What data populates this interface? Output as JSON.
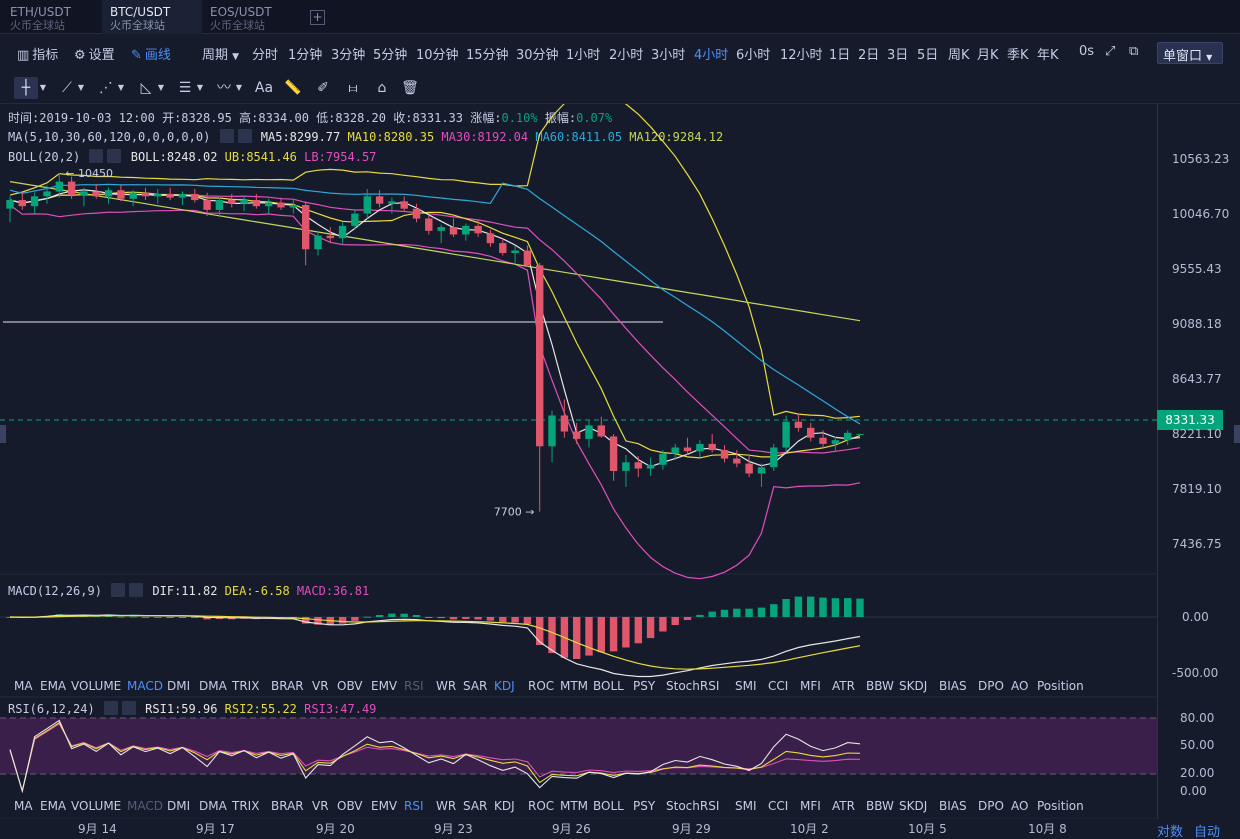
{
  "tabs": [
    {
      "pair": "ETH/USDT",
      "exchange": "火币全球站",
      "active": false
    },
    {
      "pair": "BTC/USDT",
      "exchange": "火币全球站",
      "active": true
    },
    {
      "pair": "EOS/USDT",
      "exchange": "火币全球站",
      "active": false
    }
  ],
  "toolbar": {
    "indicator": "指标",
    "settings": "设置",
    "draw": "画线",
    "period": "周期",
    "intervals": [
      "分时",
      "1分钟",
      "3分钟",
      "5分钟",
      "10分钟",
      "15分钟",
      "30分钟",
      "1小时",
      "2小时",
      "3小时",
      "4小时",
      "6小时",
      "12小时",
      "1日",
      "2日",
      "3日",
      "5日",
      "周K",
      "月K",
      "季K",
      "年K"
    ],
    "active_interval": "4小时",
    "countdown": "0s",
    "window_mode": "单窗口"
  },
  "info": {
    "time_label": "时间:",
    "time": "2019-10-03 12:00",
    "open_label": "开:",
    "open": "8328.95",
    "high_label": "高:",
    "high": "8334.00",
    "low_label": "低:",
    "low": "8328.20",
    "close_label": "收:",
    "close": "8331.33",
    "change_label": "涨幅:",
    "change": "0.10%",
    "amp_label": "振幅:",
    "amp": "0.07%"
  },
  "ma": {
    "params": "MA(5,10,30,60,120,0,0,0,0,0)",
    "ma5": "MA5:8299.77",
    "ma10": "MA10:8280.35",
    "ma30": "MA30:8192.04",
    "ma60": "MA60:8411.05",
    "ma120": "MA120:9284.12"
  },
  "boll": {
    "params": "BOLL(20,2)",
    "boll": "BOLL:8248.02",
    "ub": "UB:8541.46",
    "lb": "LB:7954.57"
  },
  "macd": {
    "params": "MACD(12,26,9)",
    "dif": "DIF:11.82",
    "dea": "DEA:-6.58",
    "macd": "MACD:36.81"
  },
  "rsi": {
    "params": "RSI(6,12,24)",
    "rsi1": "RSI1:59.96",
    "rsi2": "RSI2:55.22",
    "rsi3": "RSI3:47.49"
  },
  "indicator_list": [
    "MA",
    "EMA",
    "VOLUME",
    "MACD",
    "DMI",
    "DMA",
    "TRIX",
    "BRAR",
    "VR",
    "OBV",
    "EMV",
    "RSI",
    "WR",
    "SAR",
    "KDJ",
    "ROC",
    "MTM",
    "BOLL",
    "PSY",
    "StochRSI",
    "SMI",
    "CCI",
    "MFI",
    "ATR",
    "BBW",
    "SKDJ",
    "BIAS",
    "DPO",
    "AO",
    "Position"
  ],
  "indicator_list_1_active": "MACD",
  "indicator_list_1_active2": "KDJ",
  "indicator_list_1_dim": "RSI",
  "indicator_list_2_active": "RSI",
  "indicator_list_2_dim": "MACD",
  "price_axis": [
    "10563.23",
    "10046.70",
    "9555.43",
    "9088.18",
    "8643.77",
    "8221.10",
    "7819.10",
    "7436.75"
  ],
  "last_price": "8331.33",
  "high_marker": "← 10450",
  "low_marker": "7700 →",
  "macd_axis": [
    "0.00",
    "-500.00"
  ],
  "rsi_axis": [
    "80.00",
    "50.00",
    "20.00",
    "0.00"
  ],
  "date_axis": [
    "9月 14",
    "9月 17",
    "9月 20",
    "9月 23",
    "9月 26",
    "9月 29",
    "10月 2",
    "10月 5",
    "10月 8"
  ],
  "corner": {
    "log": "对数",
    "auto": "自动"
  },
  "colors": {
    "bg": "#161b2c",
    "up": "#05a47a",
    "down": "#e0566a",
    "accent": "#4e8ef7",
    "ma5": "#e6e6e6",
    "ma10": "#e8dc3c",
    "ma30": "#e04fbd",
    "ma60": "#2fa8d8",
    "ma120": "#c4d65a"
  },
  "chart_data": {
    "type": "candlestick",
    "series_names": [
      "MA5",
      "MA10",
      "MA30",
      "MA60",
      "MA120",
      "BOLL",
      "UB",
      "LB"
    ],
    "candles": [
      [
        10160,
        10260,
        10050,
        10230
      ],
      [
        10230,
        10300,
        10150,
        10180
      ],
      [
        10180,
        10290,
        10120,
        10260
      ],
      [
        10260,
        10350,
        10200,
        10300
      ],
      [
        10300,
        10450,
        10250,
        10380
      ],
      [
        10380,
        10420,
        10240,
        10270
      ],
      [
        10270,
        10330,
        10180,
        10300
      ],
      [
        10300,
        10360,
        10240,
        10260
      ],
      [
        10260,
        10330,
        10200,
        10310
      ],
      [
        10310,
        10350,
        10220,
        10240
      ],
      [
        10240,
        10310,
        10180,
        10290
      ],
      [
        10290,
        10330,
        10230,
        10260
      ],
      [
        10260,
        10320,
        10200,
        10280
      ],
      [
        10280,
        10330,
        10230,
        10250
      ],
      [
        10250,
        10300,
        10190,
        10280
      ],
      [
        10280,
        10320,
        10210,
        10230
      ],
      [
        10230,
        10290,
        10100,
        10150
      ],
      [
        10150,
        10250,
        10090,
        10230
      ],
      [
        10230,
        10280,
        10170,
        10200
      ],
      [
        10200,
        10260,
        10140,
        10230
      ],
      [
        10230,
        10280,
        10160,
        10180
      ],
      [
        10180,
        10240,
        10120,
        10210
      ],
      [
        10210,
        10250,
        10150,
        10170
      ],
      [
        10170,
        10230,
        10120,
        10190
      ],
      [
        10190,
        10220,
        9700,
        9830
      ],
      [
        9830,
        9980,
        9780,
        9940
      ],
      [
        9940,
        10010,
        9880,
        9920
      ],
      [
        9920,
        10050,
        9870,
        10020
      ],
      [
        10020,
        10150,
        9990,
        10120
      ],
      [
        10120,
        10320,
        10080,
        10260
      ],
      [
        10260,
        10310,
        10170,
        10200
      ],
      [
        10200,
        10250,
        10120,
        10220
      ],
      [
        10220,
        10260,
        10140,
        10160
      ],
      [
        10160,
        10200,
        10050,
        10080
      ],
      [
        10080,
        10110,
        9950,
        9980
      ],
      [
        9980,
        10030,
        9880,
        10010
      ],
      [
        10010,
        10080,
        9930,
        9950
      ],
      [
        9950,
        10040,
        9900,
        10020
      ],
      [
        10020,
        10070,
        9930,
        9960
      ],
      [
        9960,
        9990,
        9850,
        9880
      ],
      [
        9880,
        9920,
        9780,
        9800
      ],
      [
        9800,
        9860,
        9720,
        9820
      ],
      [
        9820,
        9860,
        9690,
        9700
      ],
      [
        9700,
        9720,
        7700,
        8230
      ],
      [
        8230,
        8520,
        8100,
        8480
      ],
      [
        8480,
        8610,
        8300,
        8350
      ],
      [
        8350,
        8420,
        8250,
        8290
      ],
      [
        8290,
        8440,
        8220,
        8400
      ],
      [
        8400,
        8470,
        8300,
        8310
      ],
      [
        8310,
        8330,
        7950,
        8030
      ],
      [
        8030,
        8160,
        7900,
        8100
      ],
      [
        8100,
        8150,
        7980,
        8050
      ],
      [
        8050,
        8140,
        7990,
        8080
      ],
      [
        8080,
        8200,
        8040,
        8170
      ],
      [
        8170,
        8250,
        8120,
        8220
      ],
      [
        8220,
        8300,
        8160,
        8190
      ],
      [
        8190,
        8280,
        8140,
        8250
      ],
      [
        8250,
        8330,
        8180,
        8200
      ],
      [
        8200,
        8240,
        8100,
        8130
      ],
      [
        8130,
        8200,
        8060,
        8090
      ],
      [
        8090,
        8160,
        7980,
        8010
      ],
      [
        8010,
        8090,
        7900,
        8060
      ],
      [
        8060,
        8250,
        8030,
        8220
      ],
      [
        8220,
        8480,
        8180,
        8430
      ],
      [
        8430,
        8500,
        8350,
        8380
      ],
      [
        8380,
        8420,
        8270,
        8300
      ],
      [
        8300,
        8360,
        8210,
        8250
      ],
      [
        8250,
        8310,
        8190,
        8280
      ],
      [
        8280,
        8360,
        8240,
        8340
      ],
      [
        8329,
        8334,
        8328,
        8331
      ]
    ],
    "ma_summary": {
      "MA5": 8299.77,
      "MA10": 8280.35,
      "MA30": 8192.04,
      "MA60": 8411.05,
      "MA120": 9284.12
    },
    "boll_summary": {
      "BOLL": 8248.02,
      "UB": 8541.46,
      "LB": 7954.57
    },
    "macd_summary": {
      "DIF": 11.82,
      "DEA": -6.58,
      "MACD": 36.81
    },
    "rsi_summary": {
      "RSI1": 59.96,
      "RSI2": 55.22,
      "RSI3": 47.49
    },
    "rsi_bands": [
      20,
      80
    ]
  }
}
